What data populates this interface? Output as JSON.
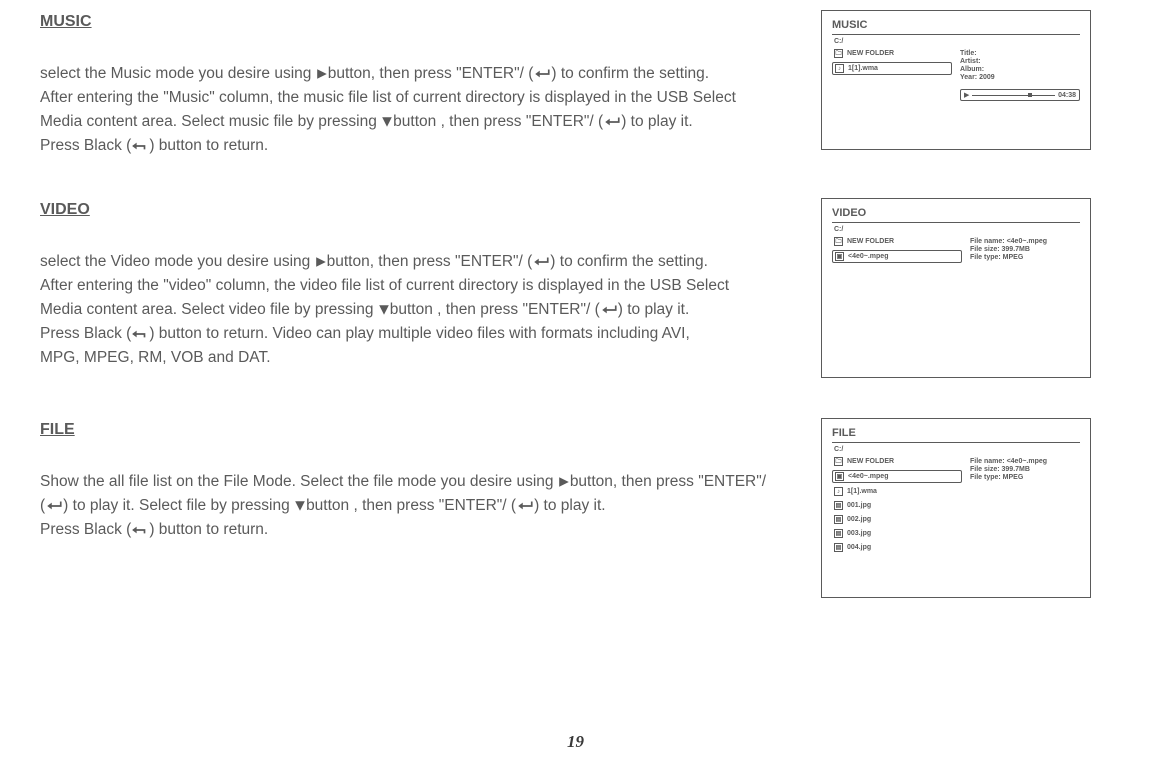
{
  "page_number": "19",
  "sections": {
    "music": {
      "heading": "MUSIC",
      "para_parts": {
        "p1a": "select the Music mode you desire using ",
        "p1b": "button, then press \"ENTER\"/ (",
        "p1c": ") to confirm the setting.",
        "p2": "After entering the \"Music\" column, the music file list of current directory is displayed in the USB Select",
        "p3a": "Media content area. Select music file by pressing ",
        "p3b": "button , then press \"ENTER\"/ (",
        "p3c": ") to play it.",
        "p4a": "Press Black (",
        "p4b": ") button to return."
      }
    },
    "video": {
      "heading": "VIDEO",
      "para_parts": {
        "p1a": "select the Video mode you desire using ",
        "p1b": "button, then press \"ENTER\"/ (",
        "p1c": ") to confirm the setting.",
        "p2": "After entering the \"video\" column, the video file list of current directory is displayed in the USB Select",
        "p3a": "Media content area. Select video file by pressing ",
        "p3b": "button , then press \"ENTER\"/ (",
        "p3c": ") to play it.",
        "p4a": "Press Black (",
        "p4b": ") button to return. Video can play multiple video files with formats including AVI,",
        "p5": "MPG, MPEG, RM, VOB and DAT."
      }
    },
    "file": {
      "heading": "FILE",
      "para_parts": {
        "p1a": "Show the all file list on the File Mode. Select the file mode you desire using ",
        "p1b": "button, then press \"ENTER\"/",
        "p2a": "(",
        "p2b": ") to play it. Select file by pressing ",
        "p2c": "button , then press \"ENTER\"/ (",
        "p2d": ") to play it.",
        "p3a": "Press Black (",
        "p3b": ") button to return."
      }
    }
  },
  "panels": {
    "music": {
      "title": "MUSIC",
      "path": "C:/",
      "items": [
        {
          "icon": "folder",
          "label": "NEW FOLDER"
        },
        {
          "icon": "music",
          "label": "1[1].wma",
          "selected": true
        }
      ],
      "info": {
        "l1": "Title:",
        "l2": "Artist:",
        "l3": "Album:",
        "l4": "Year: 2009"
      },
      "progress_time": "04:38"
    },
    "video": {
      "title": "VIDEO",
      "path": "C:/",
      "items": [
        {
          "icon": "folder",
          "label": "NEW FOLDER"
        },
        {
          "icon": "video",
          "label": "<4e0~.mpeg",
          "selected": true
        }
      ],
      "info": {
        "l1": "File name: <4e0~.mpeg",
        "l2": "File size: 399.7MB",
        "l3": "File type: MPEG"
      }
    },
    "file": {
      "title": "FILE",
      "path": "C:/",
      "items": [
        {
          "icon": "folder",
          "label": "NEW FOLDER"
        },
        {
          "icon": "video",
          "label": "<4e0~.mpeg",
          "selected": true
        },
        {
          "icon": "music",
          "label": "1[1].wma"
        },
        {
          "icon": "image",
          "label": "001.jpg"
        },
        {
          "icon": "image",
          "label": "002.jpg"
        },
        {
          "icon": "image",
          "label": "003.jpg"
        },
        {
          "icon": "image",
          "label": "004.jpg"
        }
      ],
      "info": {
        "l1": "File name: <4e0~.mpeg",
        "l2": "File size: 399.7MB",
        "l3": "File type: MPEG"
      }
    }
  },
  "icons_unicode": {
    "folder": "🗀",
    "music": "♪",
    "video": "▣",
    "image": "▤"
  }
}
